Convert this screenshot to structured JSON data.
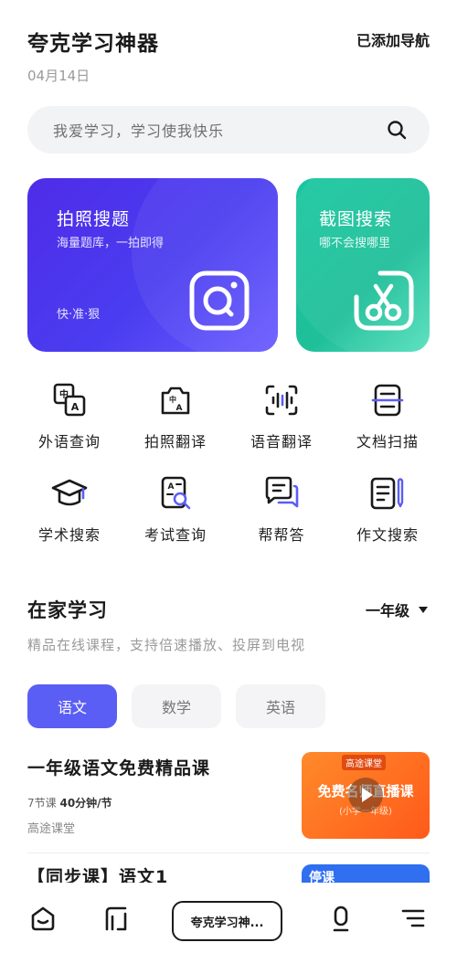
{
  "header": {
    "title": "夸克学习神器",
    "date": "04月14日",
    "added_nav": "已添加导航"
  },
  "search": {
    "placeholder": "我爱学习，学习使我快乐",
    "icon": "search-icon"
  },
  "cards": {
    "photo": {
      "title": "拍照搜题",
      "subtitle": "海量题库，一拍即得",
      "tag": "快·准·狠",
      "icon": "camera-search-icon"
    },
    "screenshot": {
      "title": "截图搜索",
      "subtitle": "哪不会搜哪里",
      "icon": "scissors-icon"
    }
  },
  "tools_row1": [
    {
      "label": "外语查询",
      "icon": "translate-zh-a-icon"
    },
    {
      "label": "拍照翻译",
      "icon": "camera-translate-icon"
    },
    {
      "label": "语音翻译",
      "icon": "voice-wave-icon"
    },
    {
      "label": "文档扫描",
      "icon": "document-scan-icon"
    }
  ],
  "tools_row2": [
    {
      "label": "学术搜索",
      "icon": "graduation-cap-icon"
    },
    {
      "label": "考试查询",
      "icon": "exam-search-icon"
    },
    {
      "label": "帮帮答",
      "icon": "chat-bubbles-icon"
    },
    {
      "label": "作文搜索",
      "icon": "essay-pen-icon"
    }
  ],
  "section": {
    "title": "在家学习",
    "subtitle": "精品在线课程，支持倍速播放、投屏到电视",
    "grade": "一年级"
  },
  "tabs": [
    {
      "label": "语文",
      "active": true
    },
    {
      "label": "数学",
      "active": false
    },
    {
      "label": "英语",
      "active": false
    }
  ],
  "courses": [
    {
      "title": "一年级语文免费精品课",
      "lessons": "7节课",
      "duration": "40分钟/节",
      "provider": "高途课堂",
      "thumb_brand": "高途课堂",
      "thumb_title": "免费名师直播课",
      "thumb_sub": "(小学一年级)"
    },
    {
      "title": "【同步课】语文1",
      "thumb_text": "停课"
    }
  ],
  "bottom_nav": {
    "center_label": "夸克学习神...",
    "icons": [
      "home-icon",
      "tabs-icon",
      "microphone-icon",
      "menu-icon"
    ]
  },
  "colors": {
    "accent": "#5b5ef4",
    "photo_card": "#4f2ce8",
    "screenshot_card": "#1fbf9a",
    "thumb_orange": "#ff6a1f"
  }
}
